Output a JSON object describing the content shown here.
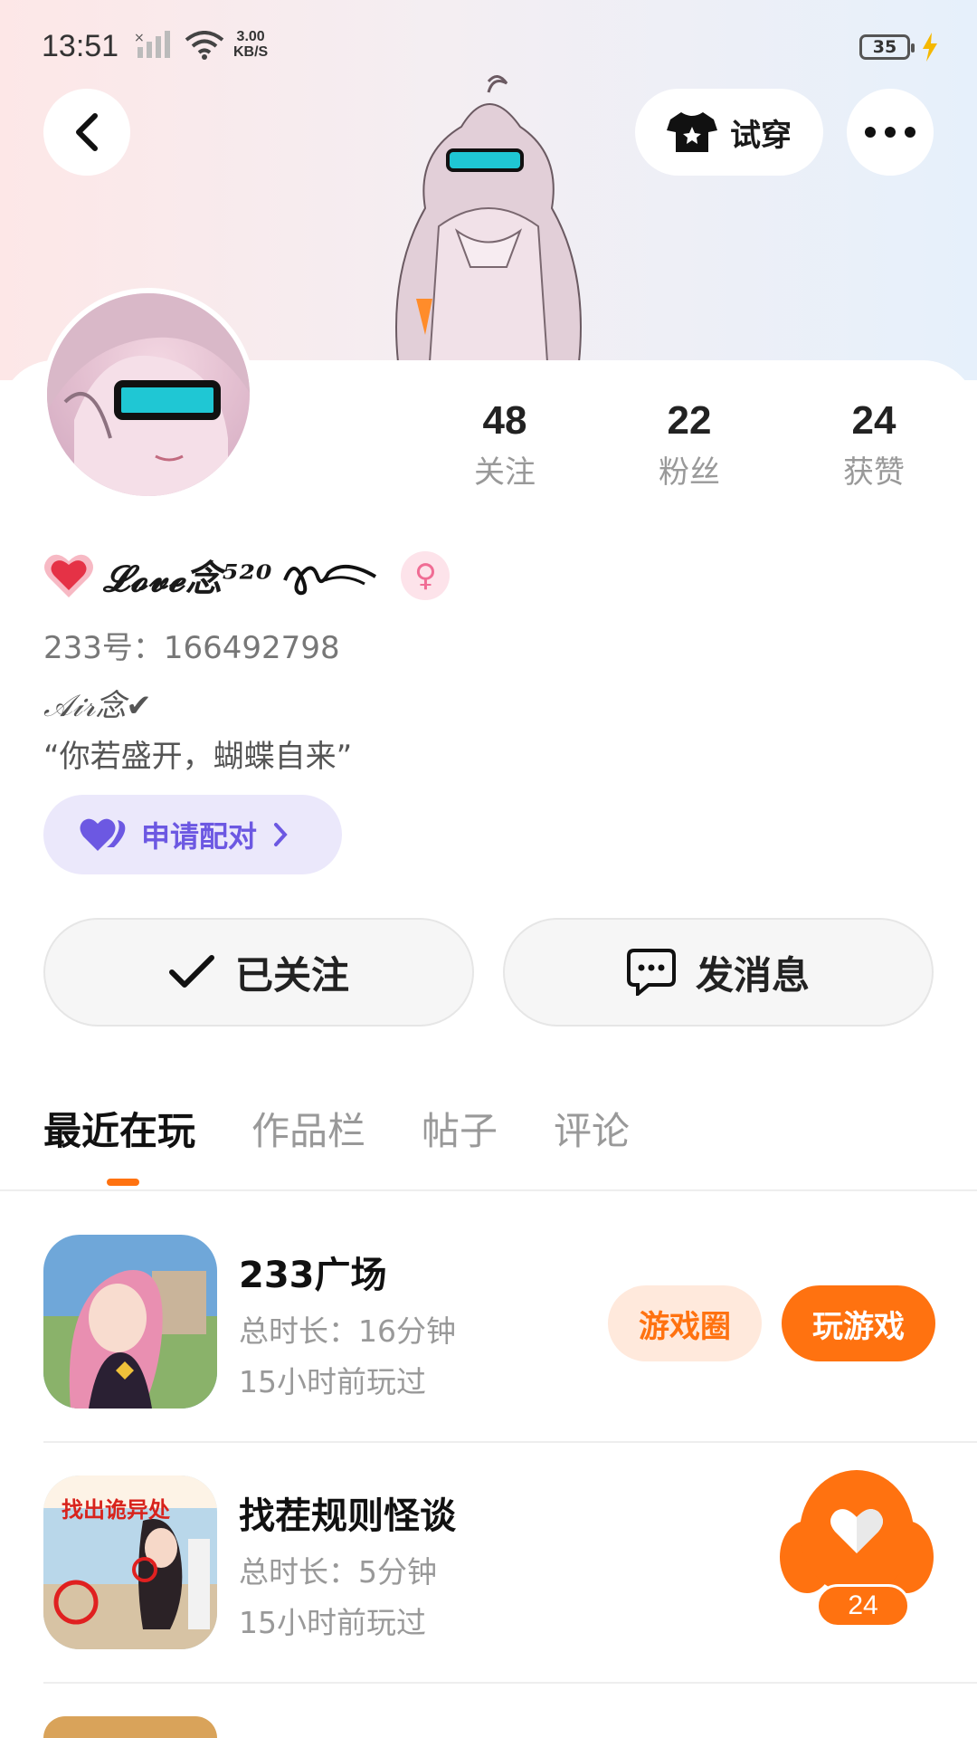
{
  "status_bar": {
    "time": "13:51",
    "net_speed_value": "3.00",
    "net_speed_unit": "KB/S",
    "battery": "35"
  },
  "header": {
    "tryon_label": "试穿"
  },
  "stats": [
    {
      "value": "48",
      "label": "关注"
    },
    {
      "value": "22",
      "label": "粉丝"
    },
    {
      "value": "24",
      "label": "获赞"
    }
  ],
  "profile": {
    "nickname": "𝓛𝓸𝓿𝓮念⁵²⁰",
    "uid": "233号：166492798",
    "signature": "𝒜𝒾𝓇念✔",
    "bio": "“你若盛开，蝴蝶自来”",
    "pair_label": "申请配对"
  },
  "actions": {
    "followed_label": "已关注",
    "message_label": "发消息"
  },
  "tabs": [
    {
      "label": "最近在玩",
      "active": true
    },
    {
      "label": "作品栏",
      "active": false
    },
    {
      "label": "帖子",
      "active": false
    },
    {
      "label": "评论",
      "active": false
    }
  ],
  "games": [
    {
      "title": "233广场",
      "duration": "总时长：16分钟",
      "last_played": "15小时前玩过",
      "circle_label": "游戏圈",
      "play_label": "玩游戏"
    },
    {
      "title": "找茬规则怪谈",
      "duration": "总时长：5分钟",
      "last_played": "15小时前玩过",
      "icon_text": "找出诡异处"
    }
  ],
  "like_fab": {
    "count": "24"
  },
  "colors": {
    "accent": "#ff7210",
    "pair_purple": "#6c58e2",
    "gender_pink": "#f06c94"
  }
}
